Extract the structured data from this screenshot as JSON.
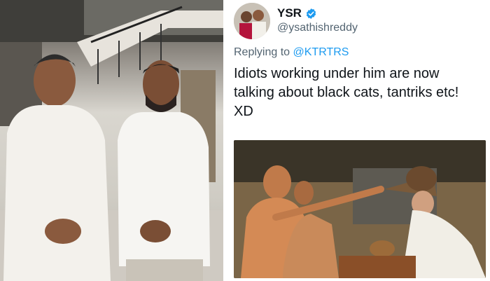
{
  "left_image": {
    "description_icon": "photo-two-men-white-shirts"
  },
  "tweet": {
    "display_name": "YSR",
    "handle": "@ysathishreddy",
    "verified_icon": "verified-badge-icon",
    "reply_prefix": "Replying to",
    "reply_mention": "@KTRTRS",
    "text": "Idiots working under him are now\ntalking about black cats, tantriks etc!\nXD",
    "colors": {
      "name": "#0f1419",
      "secondary": "#536471",
      "link": "#1d9bf0"
    }
  }
}
